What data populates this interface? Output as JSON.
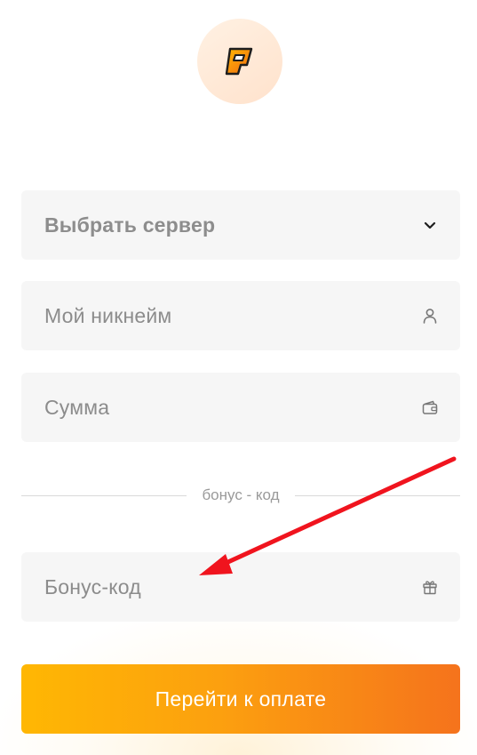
{
  "logo": {
    "icon": "brand-logo-icon",
    "colors": {
      "outer": "#f5931e",
      "inner": "#1d1d1d"
    }
  },
  "form": {
    "server_select": {
      "label": "Выбрать сервер",
      "icon": "chevron-down-icon"
    },
    "nickname": {
      "placeholder": "Мой никнейм",
      "icon": "user-icon"
    },
    "amount": {
      "placeholder": "Сумма",
      "icon": "wallet-icon"
    },
    "divider_label": "бонус - код",
    "bonus_code": {
      "placeholder": "Бонус-код",
      "icon": "gift-icon"
    },
    "submit_label": "Перейти к оплате"
  },
  "annotation": {
    "type": "arrow",
    "color": "#f0141e",
    "points_to": "bonus-code-field"
  },
  "colors": {
    "field_bg": "#f6f6f6",
    "placeholder": "#8c8c8c",
    "button_gradient": [
      "#ffb703",
      "#f5731c"
    ],
    "button_text": "#ffffff"
  }
}
